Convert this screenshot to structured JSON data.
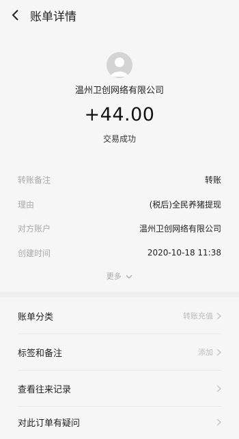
{
  "header": {
    "title": "账单详情"
  },
  "merchant": {
    "name": "温州卫创网络有限公司"
  },
  "transaction": {
    "amount": "+44.00",
    "status": "交易成功"
  },
  "details": [
    {
      "label": "转账备注",
      "value": "转账"
    },
    {
      "label": "理由",
      "value": "(税后)全民养猪提现"
    },
    {
      "label": "对方账户",
      "value": "温州卫创网络有限公司"
    },
    {
      "label": "创建时间",
      "value": "2020-10-18 11:38"
    }
  ],
  "more_label": "更多",
  "menu": [
    {
      "label": "账单分类",
      "value": "转账充值"
    },
    {
      "label": "标签和备注",
      "value": "添加"
    },
    {
      "label": "查看往来记录",
      "value": ""
    },
    {
      "label": "对此订单有疑问",
      "value": ""
    }
  ]
}
